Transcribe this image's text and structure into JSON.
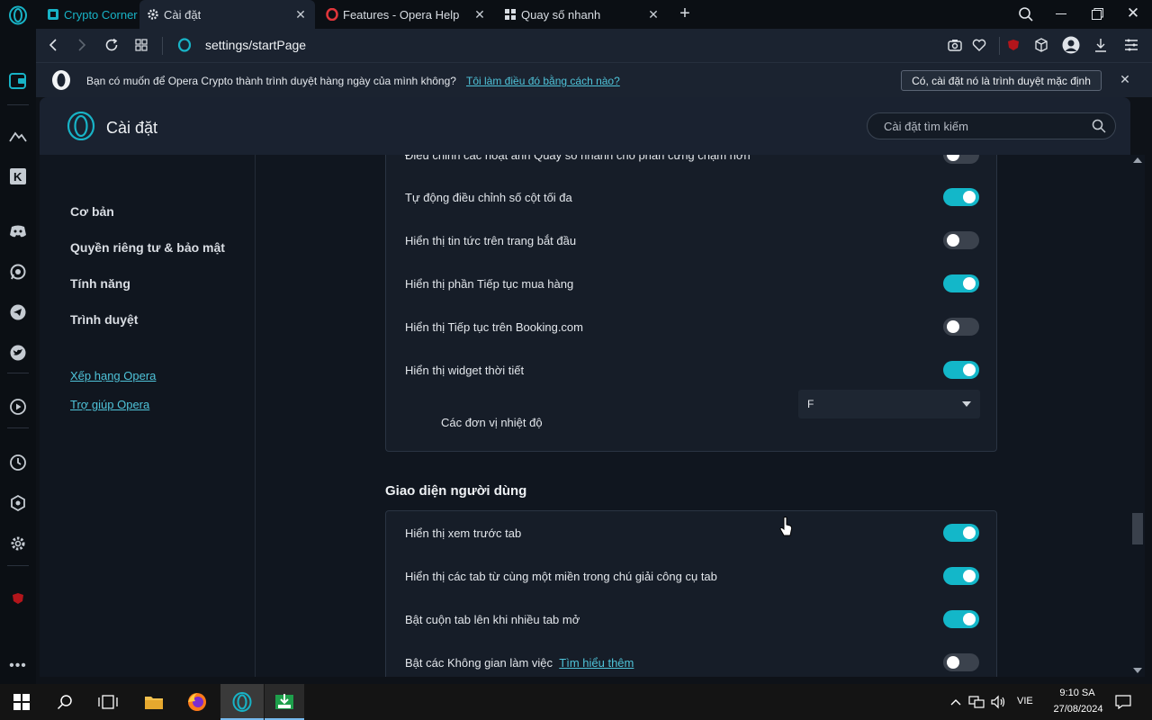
{
  "tabs": [
    {
      "label": "Crypto Corner",
      "icon": "crypto-corner-icon",
      "active": false
    },
    {
      "label": "Cài đặt",
      "icon": "gear-icon",
      "active": true
    },
    {
      "label": "Features - Opera Help",
      "icon": "opera-icon",
      "active": false
    },
    {
      "label": "Quay số nhanh",
      "icon": "grid-icon",
      "active": false
    }
  ],
  "window_controls": {
    "search": "search-icon",
    "minimize": "minimize-icon",
    "maximize": "maximize-icon",
    "close": "close-icon"
  },
  "address": {
    "url_host": "settings",
    "url_path": "/startPage"
  },
  "banner": {
    "text": "Bạn có muốn để Opera Crypto thành trình duyệt hàng ngày của mình không?",
    "link": "Tôi làm điều đó bằng cách nào?",
    "button": "Có, cài đặt nó là trình duyệt mặc định"
  },
  "settings": {
    "title": "Cài đặt",
    "search_placeholder": "Cài đặt tìm kiếm",
    "nav": [
      "Cơ bản",
      "Quyền riêng tư & bảo mật",
      "Tính năng",
      "Trình duyệt"
    ],
    "nav_links": [
      "Xếp hạng Opera",
      "Trợ giúp Opera"
    ]
  },
  "partial_row": "Điều chỉnh các hoạt ảnh Quay số nhanh cho phần cứng chậm hơn",
  "start_page_rows": [
    {
      "label": "Tự động điều chỉnh số cột tối đa",
      "on": true
    },
    {
      "label": "Hiển thị tin tức trên trang bắt đầu",
      "on": false
    },
    {
      "label": "Hiển thị phần Tiếp tục mua hàng",
      "on": true
    },
    {
      "label": "Hiển thị Tiếp tục trên Booking.com",
      "on": false
    },
    {
      "label": "Hiển thị widget thời tiết",
      "on": true
    }
  ],
  "temperature": {
    "label": "Các đơn vị nhiệt độ",
    "value": "F"
  },
  "ui_section": {
    "title": "Giao diện người dùng",
    "rows": [
      {
        "label": "Hiển thị xem trước tab",
        "on": true
      },
      {
        "label": "Hiển thị các tab từ cùng một miền trong chú giải công cụ tab",
        "on": true
      },
      {
        "label": "Bật cuộn tab lên khi nhiều tab mở",
        "on": true
      },
      {
        "label": "Bật các Không gian làm việc",
        "on": false,
        "link": "Tìm hiểu thêm"
      }
    ]
  },
  "taskbar": {
    "lang": "VIE",
    "time": "9:10 SA",
    "date": "27/08/2024"
  },
  "colors": {
    "accent": "#13b7c9",
    "link": "#4fc3d9",
    "background": "#10161f"
  }
}
